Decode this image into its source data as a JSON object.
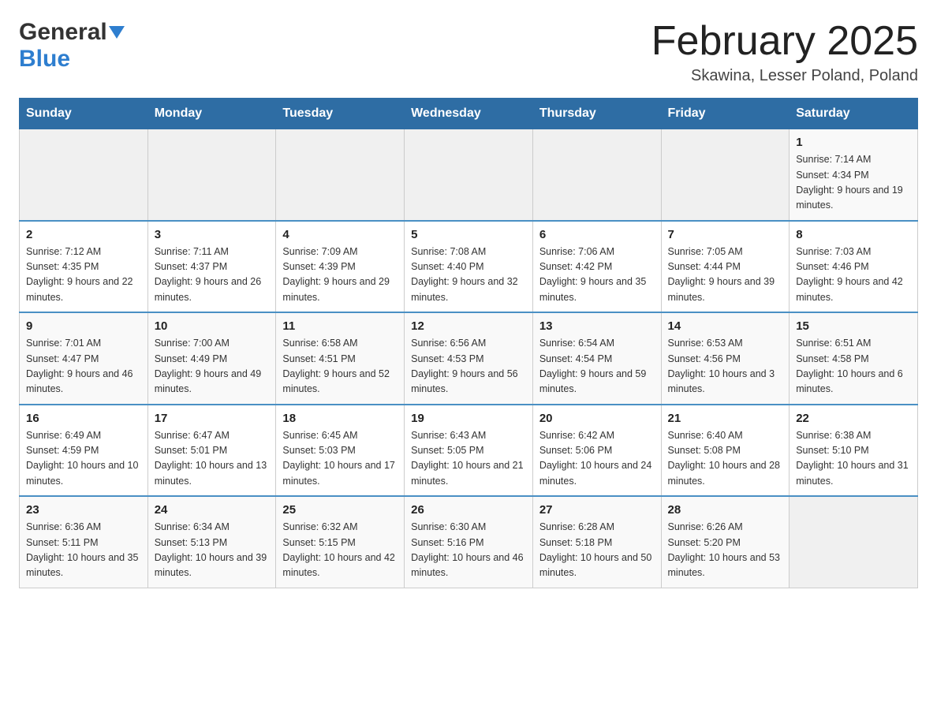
{
  "logo": {
    "general": "General",
    "blue": "Blue",
    "triangle_aria": "logo triangle"
  },
  "title": {
    "month_year": "February 2025",
    "location": "Skawina, Lesser Poland, Poland"
  },
  "weekdays": [
    "Sunday",
    "Monday",
    "Tuesday",
    "Wednesday",
    "Thursday",
    "Friday",
    "Saturday"
  ],
  "weeks": [
    [
      {
        "day": "",
        "info": ""
      },
      {
        "day": "",
        "info": ""
      },
      {
        "day": "",
        "info": ""
      },
      {
        "day": "",
        "info": ""
      },
      {
        "day": "",
        "info": ""
      },
      {
        "day": "",
        "info": ""
      },
      {
        "day": "1",
        "info": "Sunrise: 7:14 AM\nSunset: 4:34 PM\nDaylight: 9 hours and 19 minutes."
      }
    ],
    [
      {
        "day": "2",
        "info": "Sunrise: 7:12 AM\nSunset: 4:35 PM\nDaylight: 9 hours and 22 minutes."
      },
      {
        "day": "3",
        "info": "Sunrise: 7:11 AM\nSunset: 4:37 PM\nDaylight: 9 hours and 26 minutes."
      },
      {
        "day": "4",
        "info": "Sunrise: 7:09 AM\nSunset: 4:39 PM\nDaylight: 9 hours and 29 minutes."
      },
      {
        "day": "5",
        "info": "Sunrise: 7:08 AM\nSunset: 4:40 PM\nDaylight: 9 hours and 32 minutes."
      },
      {
        "day": "6",
        "info": "Sunrise: 7:06 AM\nSunset: 4:42 PM\nDaylight: 9 hours and 35 minutes."
      },
      {
        "day": "7",
        "info": "Sunrise: 7:05 AM\nSunset: 4:44 PM\nDaylight: 9 hours and 39 minutes."
      },
      {
        "day": "8",
        "info": "Sunrise: 7:03 AM\nSunset: 4:46 PM\nDaylight: 9 hours and 42 minutes."
      }
    ],
    [
      {
        "day": "9",
        "info": "Sunrise: 7:01 AM\nSunset: 4:47 PM\nDaylight: 9 hours and 46 minutes."
      },
      {
        "day": "10",
        "info": "Sunrise: 7:00 AM\nSunset: 4:49 PM\nDaylight: 9 hours and 49 minutes."
      },
      {
        "day": "11",
        "info": "Sunrise: 6:58 AM\nSunset: 4:51 PM\nDaylight: 9 hours and 52 minutes."
      },
      {
        "day": "12",
        "info": "Sunrise: 6:56 AM\nSunset: 4:53 PM\nDaylight: 9 hours and 56 minutes."
      },
      {
        "day": "13",
        "info": "Sunrise: 6:54 AM\nSunset: 4:54 PM\nDaylight: 9 hours and 59 minutes."
      },
      {
        "day": "14",
        "info": "Sunrise: 6:53 AM\nSunset: 4:56 PM\nDaylight: 10 hours and 3 minutes."
      },
      {
        "day": "15",
        "info": "Sunrise: 6:51 AM\nSunset: 4:58 PM\nDaylight: 10 hours and 6 minutes."
      }
    ],
    [
      {
        "day": "16",
        "info": "Sunrise: 6:49 AM\nSunset: 4:59 PM\nDaylight: 10 hours and 10 minutes."
      },
      {
        "day": "17",
        "info": "Sunrise: 6:47 AM\nSunset: 5:01 PM\nDaylight: 10 hours and 13 minutes."
      },
      {
        "day": "18",
        "info": "Sunrise: 6:45 AM\nSunset: 5:03 PM\nDaylight: 10 hours and 17 minutes."
      },
      {
        "day": "19",
        "info": "Sunrise: 6:43 AM\nSunset: 5:05 PM\nDaylight: 10 hours and 21 minutes."
      },
      {
        "day": "20",
        "info": "Sunrise: 6:42 AM\nSunset: 5:06 PM\nDaylight: 10 hours and 24 minutes."
      },
      {
        "day": "21",
        "info": "Sunrise: 6:40 AM\nSunset: 5:08 PM\nDaylight: 10 hours and 28 minutes."
      },
      {
        "day": "22",
        "info": "Sunrise: 6:38 AM\nSunset: 5:10 PM\nDaylight: 10 hours and 31 minutes."
      }
    ],
    [
      {
        "day": "23",
        "info": "Sunrise: 6:36 AM\nSunset: 5:11 PM\nDaylight: 10 hours and 35 minutes."
      },
      {
        "day": "24",
        "info": "Sunrise: 6:34 AM\nSunset: 5:13 PM\nDaylight: 10 hours and 39 minutes."
      },
      {
        "day": "25",
        "info": "Sunrise: 6:32 AM\nSunset: 5:15 PM\nDaylight: 10 hours and 42 minutes."
      },
      {
        "day": "26",
        "info": "Sunrise: 6:30 AM\nSunset: 5:16 PM\nDaylight: 10 hours and 46 minutes."
      },
      {
        "day": "27",
        "info": "Sunrise: 6:28 AM\nSunset: 5:18 PM\nDaylight: 10 hours and 50 minutes."
      },
      {
        "day": "28",
        "info": "Sunrise: 6:26 AM\nSunset: 5:20 PM\nDaylight: 10 hours and 53 minutes."
      },
      {
        "day": "",
        "info": ""
      }
    ]
  ]
}
